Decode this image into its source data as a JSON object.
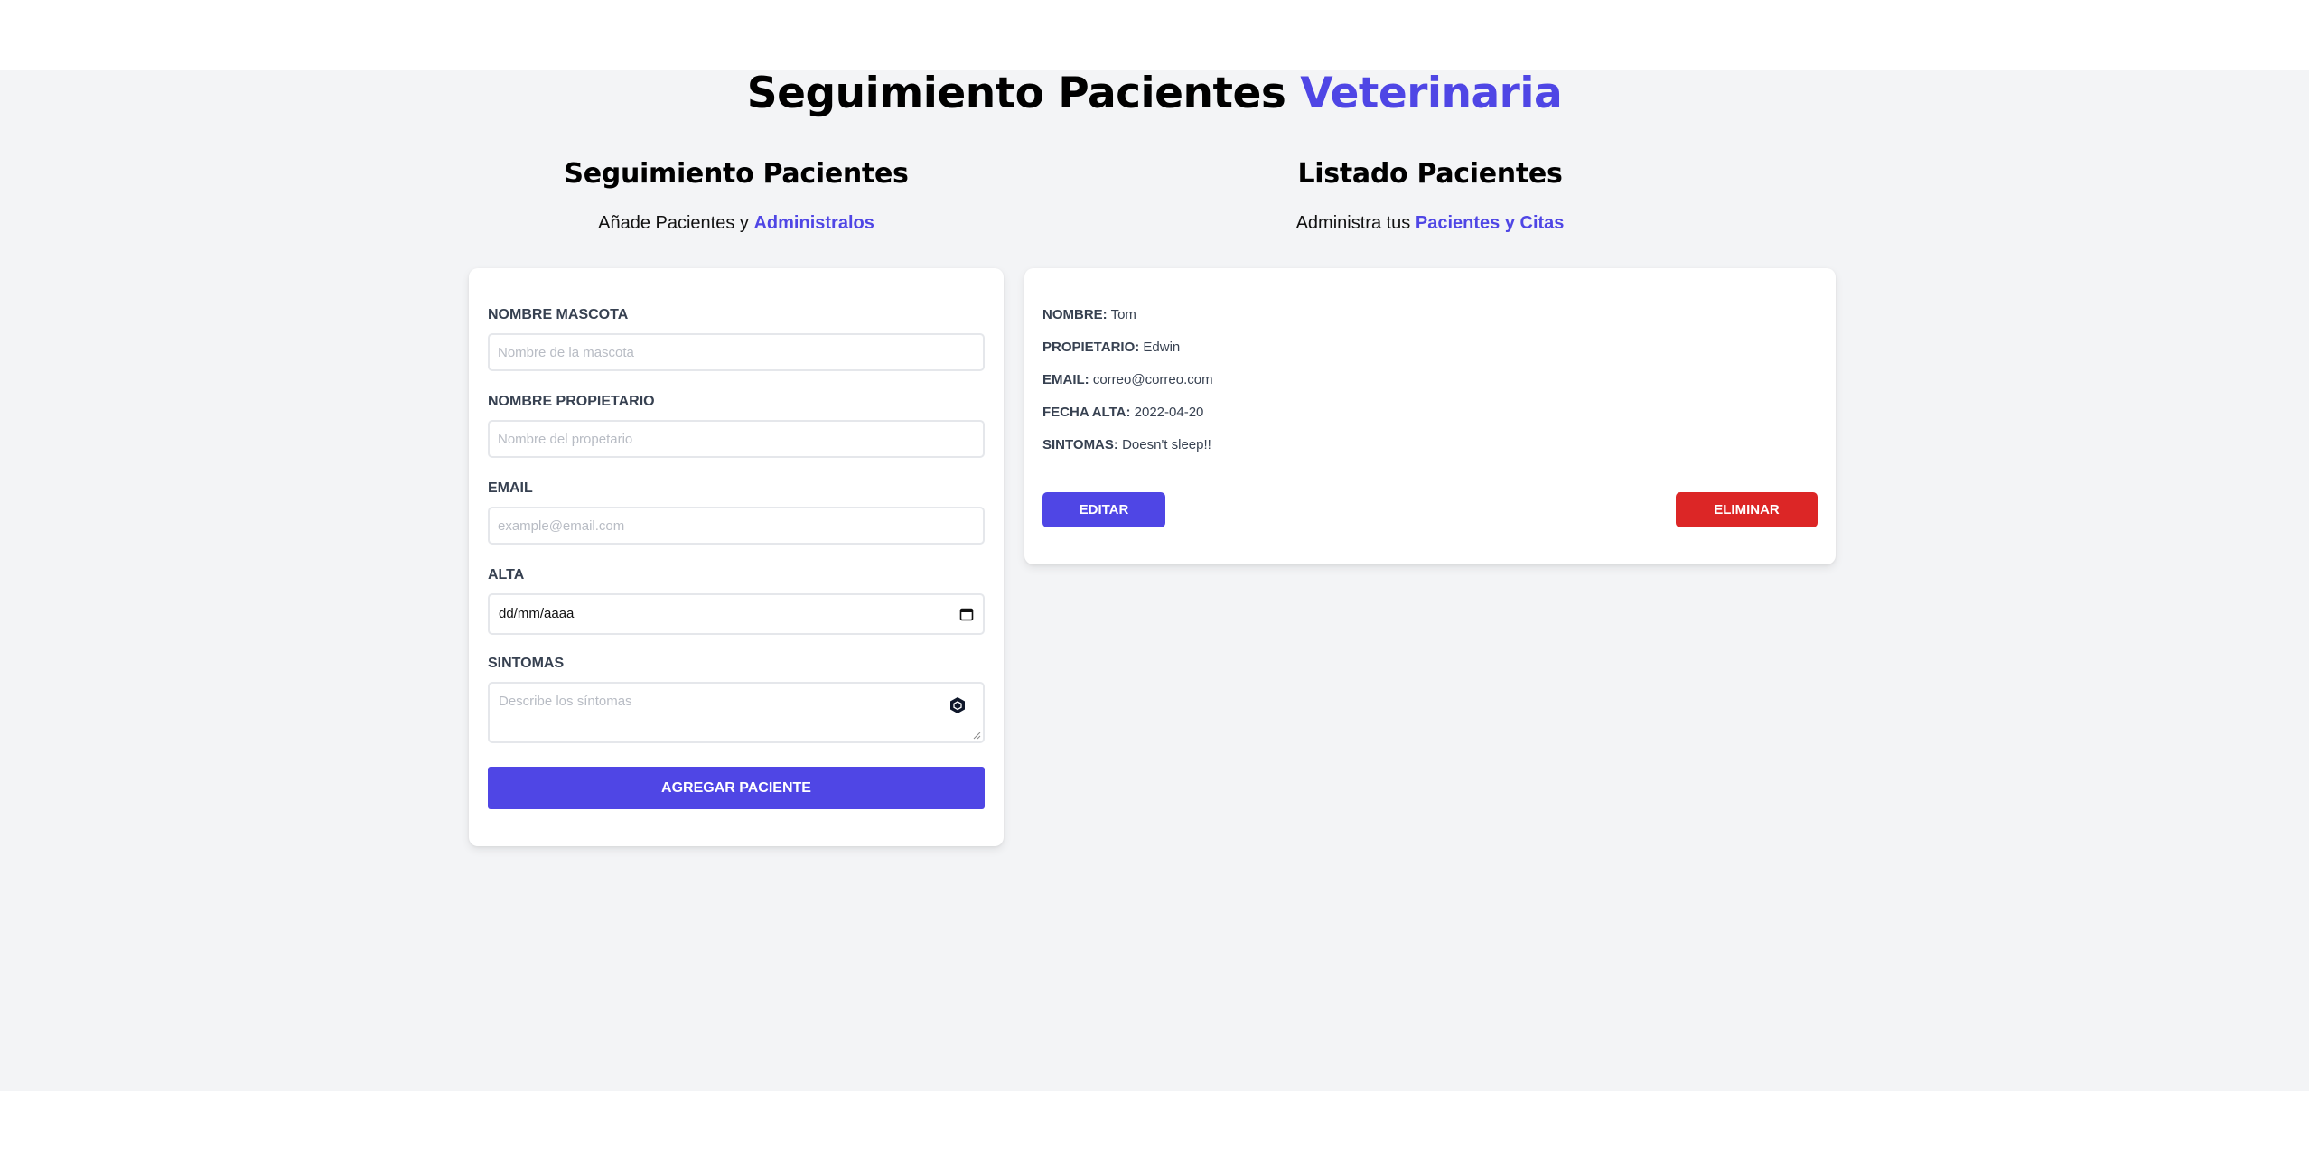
{
  "header": {
    "title_main": "Seguimiento Pacientes",
    "title_accent": "Veterinaria",
    "accent_color": "#4f46e5"
  },
  "form_section": {
    "heading": "Seguimiento Pacientes",
    "subtitle_plain": "Añade Pacientes y",
    "subtitle_accent": "Administralos",
    "fields": {
      "pet_name": {
        "label": "NOMBRE MASCOTA",
        "placeholder": "Nombre de la mascota",
        "value": ""
      },
      "owner_name": {
        "label": "NOMBRE PROPIETARIO",
        "placeholder": "Nombre del propetario",
        "value": ""
      },
      "email": {
        "label": "EMAIL",
        "placeholder": "example@email.com",
        "value": ""
      },
      "discharge": {
        "label": "ALTA",
        "display": "dd/mm/aaaa"
      },
      "symptoms": {
        "label": "SINTOMAS",
        "placeholder": "Describe los síntomas"
      }
    },
    "submit_label": "AGREGAR PACIENTE"
  },
  "list_section": {
    "heading": "Listado Pacientes",
    "subtitle_plain": "Administra tus",
    "subtitle_accent": "Pacientes y Citas",
    "patient": {
      "name_label": "NOMBRE:",
      "name": "Tom",
      "owner_label": "PROPIETARIO:",
      "owner": "Edwin",
      "email_label": "EMAIL:",
      "email": "correo@correo.com",
      "date_label": "FECHA ALTA:",
      "date": "2022-04-20",
      "symptoms_label": "SINTOMAS:",
      "symptoms": "Doesn't sleep!!"
    },
    "edit_label": "EDITAR",
    "delete_label": "ELIMINAR",
    "edit_color": "#4f46e5",
    "delete_color": "#dc2626"
  }
}
